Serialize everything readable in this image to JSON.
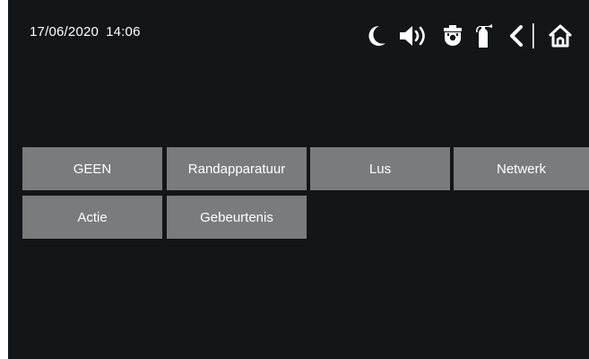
{
  "status_bar": {
    "date": "17/06/2020",
    "time": "14:06"
  },
  "toolbar": {
    "icons": [
      "night-mode-icon",
      "volume-icon",
      "fire-detector-icon",
      "fire-extinguisher-icon",
      "back-icon",
      "home-icon"
    ]
  },
  "filter_options": {
    "items": [
      {
        "label": "GEEN"
      },
      {
        "label": "Randapparatuur"
      },
      {
        "label": "Lus"
      },
      {
        "label": "Netwerk"
      },
      {
        "label": "Actie"
      },
      {
        "label": "Gebeurtenis"
      }
    ]
  },
  "colors": {
    "background": "#141518",
    "tile": "#7a7b7d",
    "text": "#ffffff"
  }
}
